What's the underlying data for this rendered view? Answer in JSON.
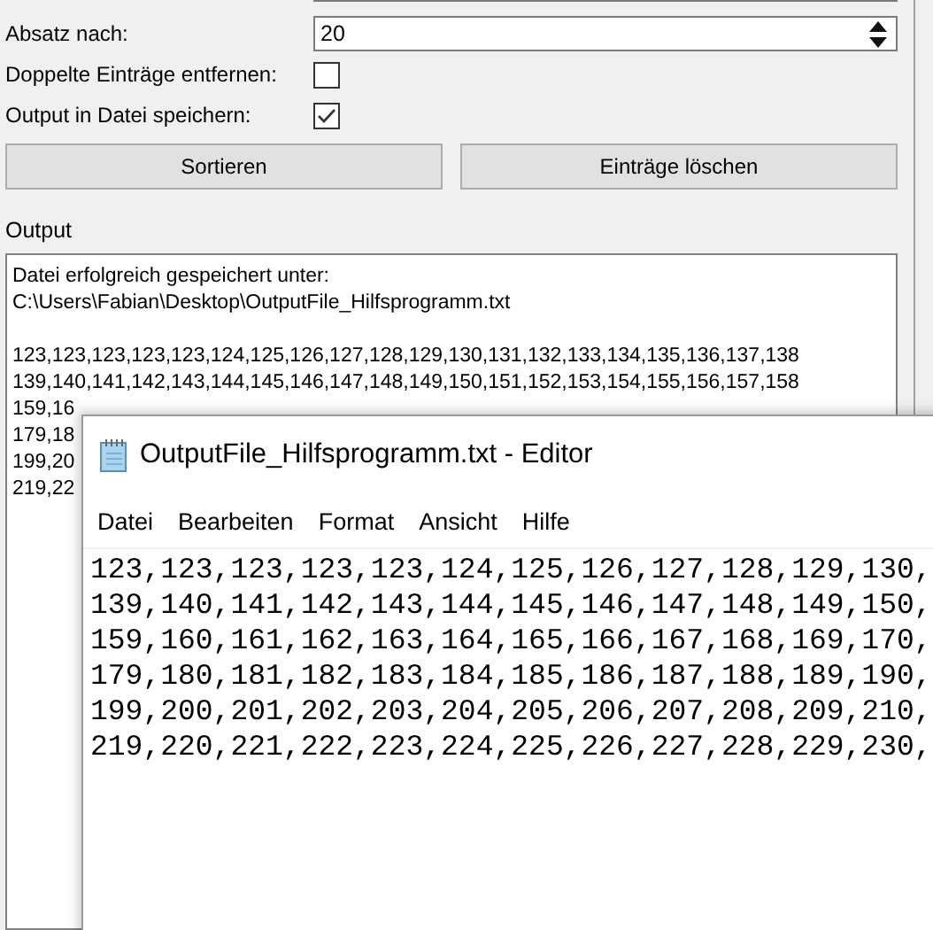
{
  "form": {
    "paragraph_label": "Absatz nach:",
    "paragraph_value": "20",
    "duplicates_label": "Doppelte Einträge entfernen:",
    "duplicates_checked": false,
    "save_label": "Output in Datei speichern:",
    "save_checked": true
  },
  "buttons": [
    "Sortieren",
    "Einträge löschen"
  ],
  "output": {
    "label": "Output",
    "message": [
      "Datei erfolgreich gespeichert unter:",
      "C:\\Users\\Fabian\\Desktop\\OutputFile_Hilfsprogramm.txt"
    ],
    "lines": [
      "123,123,123,123,123,124,125,126,127,128,129,130,131,132,133,134,135,136,137,138",
      "139,140,141,142,143,144,145,146,147,148,149,150,151,152,153,154,155,156,157,158",
      "159,16",
      "179,18",
      "199,20",
      "219,22"
    ]
  },
  "editor": {
    "title": "OutputFile_Hilfsprogramm.txt - Editor",
    "menu": [
      "Datei",
      "Bearbeiten",
      "Format",
      "Ansicht",
      "Hilfe"
    ],
    "lines": [
      "123,123,123,123,123,124,125,126,127,128,129,130,",
      "139,140,141,142,143,144,145,146,147,148,149,150,",
      "159,160,161,162,163,164,165,166,167,168,169,170,",
      "179,180,181,182,183,184,185,186,187,188,189,190,",
      "199,200,201,202,203,204,205,206,207,208,209,210,",
      "219,220,221,222,223,224,225,226,227,228,229,230,"
    ]
  }
}
